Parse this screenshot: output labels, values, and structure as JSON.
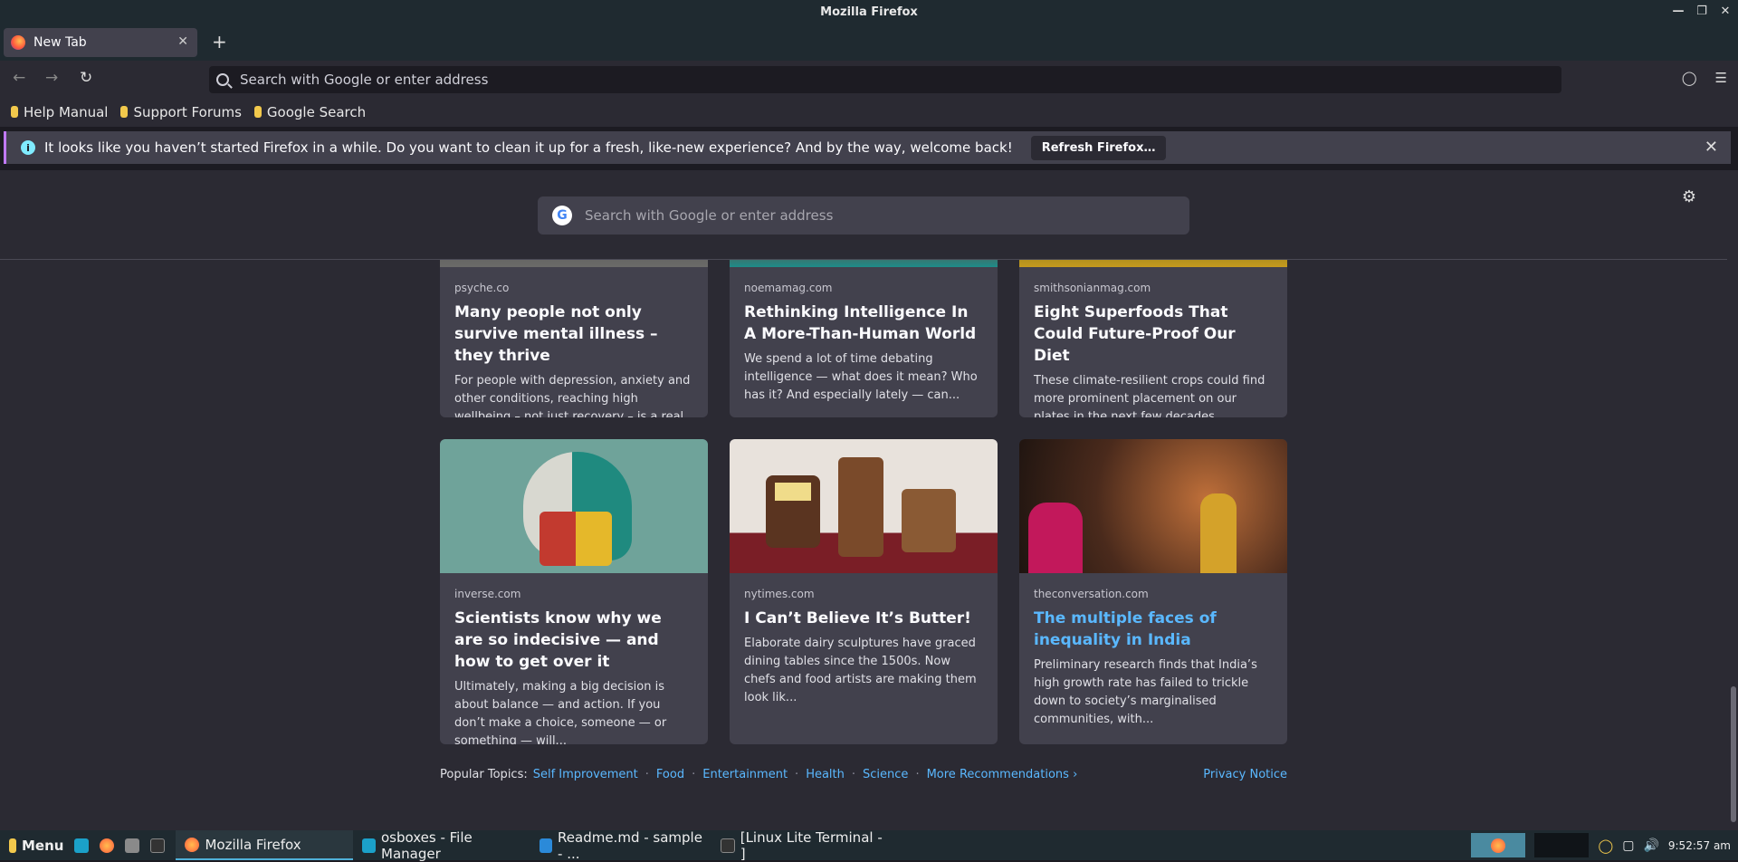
{
  "window": {
    "title": "Mozilla Firefox"
  },
  "tab": {
    "label": "New Tab"
  },
  "urlbar": {
    "placeholder": "Search with Google or enter address"
  },
  "bookmarks": [
    "Help Manual",
    "Support Forums",
    "Google Search"
  ],
  "notice": {
    "text": "It looks like you haven’t started Firefox in a while. Do you want to clean it up for a fresh, like-new experience? And by the way, welcome back!",
    "button": "Refresh Firefox…"
  },
  "newtab_search": {
    "placeholder": "Search with Google or enter address"
  },
  "cards": [
    {
      "source": "psyche.co",
      "title": "Many people not only survive mental illness – they thrive",
      "desc": "For people with depression, anxiety and other conditions, reaching high wellbeing – not just recovery – is a real possibility."
    },
    {
      "source": "noemamag.com",
      "title": "Rethinking Intelligence In A More-Than-Human World",
      "desc": "We spend a lot of time debating intelligence — what does it mean? Who has it? And especially lately — can..."
    },
    {
      "source": "smithsonianmag.com",
      "title": "Eight Superfoods That Could Future-Proof Our Diet",
      "desc": "These climate-resilient crops could find more prominent placement on our plates in the next few decades."
    },
    {
      "source": "inverse.com",
      "title": "Scientists know why we are so indecisive — and how to get over it",
      "desc": "Ultimately, making a big decision is about balance — and action. If you don’t make a choice, someone — or something — will..."
    },
    {
      "source": "nytimes.com",
      "title": "I Can’t Believe It’s Butter!",
      "desc": "Elaborate dairy sculptures have graced dining tables since the 1500s. Now chefs and food artists are making them look lik..."
    },
    {
      "source": "theconversation.com",
      "title": "The multiple faces of inequality in India",
      "desc": "Preliminary research finds that India’s high growth rate has failed to trickle down to society’s marginalised communities, with..."
    }
  ],
  "footer": {
    "label": "Popular Topics:",
    "topics": [
      "Self Improvement",
      "Food",
      "Entertainment",
      "Health",
      "Science",
      "More Recommendations ›"
    ],
    "privacy": "Privacy Notice"
  },
  "taskbar": {
    "menu": "Menu",
    "items": [
      "Mozilla Firefox",
      "osboxes - File Manager",
      "Readme.md - sample - ...",
      "[Linux Lite Terminal - ]"
    ],
    "clock": "9:52:57 am"
  }
}
